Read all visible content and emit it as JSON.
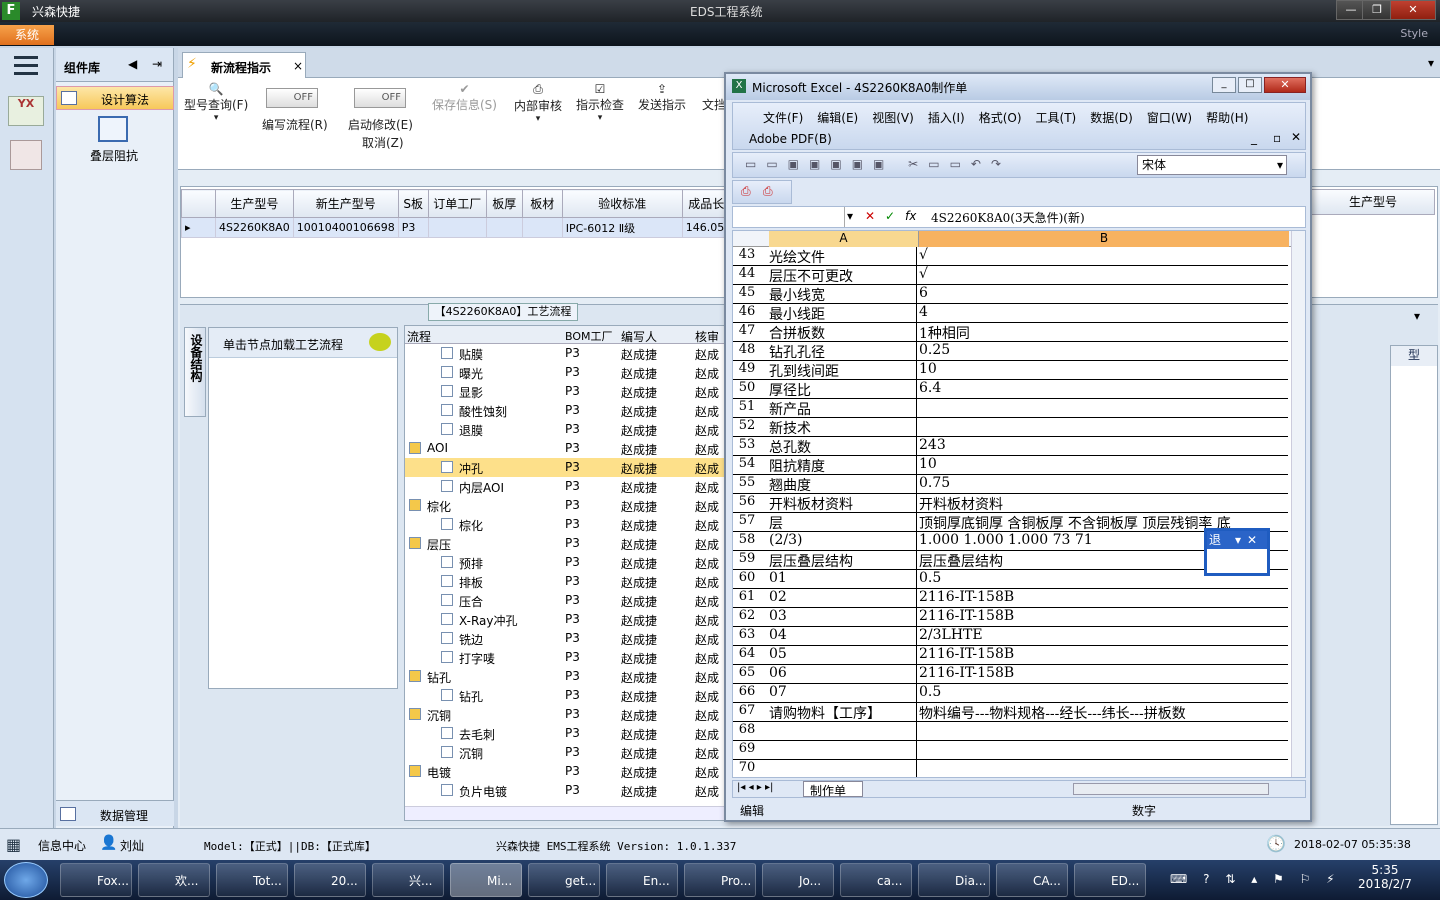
{
  "app": {
    "title": "兴森快捷",
    "window_title": "EDS工程系统",
    "style_label": "Style",
    "system_btn": "系统"
  },
  "left": {
    "panel_title": "组件库",
    "items": [
      {
        "label": "设计算法"
      },
      {
        "label": "叠层阻抗"
      }
    ],
    "bottom_item": "数据管理"
  },
  "tab": {
    "label": "新流程指示"
  },
  "toolbar": {
    "model_query": "型号查询(F)",
    "write_flow": "编写流程(R)",
    "modify": "启动修改(E)",
    "cancel": "取消(Z)",
    "save_info": "保存信息(S)",
    "internal_review": "内部审核",
    "check": "指示检查",
    "send": "发送指示",
    "doc": "文挡",
    "off": "OFF"
  },
  "grid": {
    "headers": [
      "生产型号",
      "新生产型号",
      "S板",
      "订单工厂",
      "板厚",
      "板材",
      "验收标准",
      "成品长"
    ],
    "row": [
      "4S2260K8A0",
      "10010400106698",
      "P3",
      "",
      "",
      "",
      "IPC-6012 Ⅱ级",
      "146.05"
    ],
    "right_header": "生产型号"
  },
  "flow": {
    "title": "【4S2260K8A0】工艺流程",
    "side_tab": "设备结构",
    "load_btn": "单击节点加载工艺流程",
    "cols": [
      "流程",
      "BOM工厂",
      "编写人",
      "核审"
    ],
    "rows": [
      {
        "name": "贴膜",
        "lvl": 2,
        "bom": "P3",
        "w": "赵成捷",
        "r": "赵成"
      },
      {
        "name": "曝光",
        "lvl": 2,
        "bom": "P3",
        "w": "赵成捷",
        "r": "赵成"
      },
      {
        "name": "显影",
        "lvl": 2,
        "bom": "P3",
        "w": "赵成捷",
        "r": "赵成"
      },
      {
        "name": "酸性蚀刻",
        "lvl": 2,
        "bom": "P3",
        "w": "赵成捷",
        "r": "赵成"
      },
      {
        "name": "退膜",
        "lvl": 2,
        "bom": "P3",
        "w": "赵成捷",
        "r": "赵成"
      },
      {
        "name": "AOI",
        "lvl": 1,
        "bom": "P3",
        "w": "赵成捷",
        "r": "赵成"
      },
      {
        "name": "冲孔",
        "lvl": 2,
        "bom": "P3",
        "w": "赵成捷",
        "r": "赵成",
        "sel": true
      },
      {
        "name": "内层AOI",
        "lvl": 2,
        "bom": "P3",
        "w": "赵成捷",
        "r": "赵成"
      },
      {
        "name": "棕化",
        "lvl": 1,
        "bom": "P3",
        "w": "赵成捷",
        "r": "赵成"
      },
      {
        "name": "棕化",
        "lvl": 2,
        "bom": "P3",
        "w": "赵成捷",
        "r": "赵成"
      },
      {
        "name": "层压",
        "lvl": 1,
        "bom": "P3",
        "w": "赵成捷",
        "r": "赵成"
      },
      {
        "name": "预排",
        "lvl": 2,
        "bom": "P3",
        "w": "赵成捷",
        "r": "赵成"
      },
      {
        "name": "排板",
        "lvl": 2,
        "bom": "P3",
        "w": "赵成捷",
        "r": "赵成"
      },
      {
        "name": "压合",
        "lvl": 2,
        "bom": "P3",
        "w": "赵成捷",
        "r": "赵成"
      },
      {
        "name": "X-Ray冲孔",
        "lvl": 2,
        "bom": "P3",
        "w": "赵成捷",
        "r": "赵成"
      },
      {
        "name": "铣边",
        "lvl": 2,
        "bom": "P3",
        "w": "赵成捷",
        "r": "赵成"
      },
      {
        "name": "打字唛",
        "lvl": 2,
        "bom": "P3",
        "w": "赵成捷",
        "r": "赵成"
      },
      {
        "name": "钻孔",
        "lvl": 1,
        "bom": "P3",
        "w": "赵成捷",
        "r": "赵成"
      },
      {
        "name": "钻孔",
        "lvl": 2,
        "bom": "P3",
        "w": "赵成捷",
        "r": "赵成"
      },
      {
        "name": "沉铜",
        "lvl": 1,
        "bom": "P3",
        "w": "赵成捷",
        "r": "赵成"
      },
      {
        "name": "去毛刺",
        "lvl": 2,
        "bom": "P3",
        "w": "赵成捷",
        "r": "赵成"
      },
      {
        "name": "沉铜",
        "lvl": 2,
        "bom": "P3",
        "w": "赵成捷",
        "r": "赵成"
      },
      {
        "name": "电镀",
        "lvl": 1,
        "bom": "P3",
        "w": "赵成捷",
        "r": "赵成"
      },
      {
        "name": "负片电镀",
        "lvl": 2,
        "bom": "P3",
        "w": "赵成捷",
        "r": "赵成"
      }
    ]
  },
  "excel": {
    "title": "Microsoft Excel - 4S2260K8A0制作单",
    "menus": [
      "文件(F)",
      "编辑(E)",
      "视图(V)",
      "插入(I)",
      "格式(O)",
      "工具(T)",
      "数据(D)",
      "窗口(W)",
      "帮助(H)"
    ],
    "adobe": "Adobe PDF(B)",
    "font": "宋体",
    "formula": "4S2260K8A0(3天急件)(新)",
    "col_a": "A",
    "col_b": "B",
    "sheet_tab": "制作单",
    "status_left": "编辑",
    "status_mid": "数字",
    "popup": "退",
    "rows": [
      [
        "43",
        "光绘文件",
        "√"
      ],
      [
        "44",
        "层压不可更改",
        "√"
      ],
      [
        "45",
        "最小线宽",
        "6"
      ],
      [
        "46",
        "最小线距",
        "4"
      ],
      [
        "47",
        "合拼板数",
        "1种相同"
      ],
      [
        "48",
        "钻孔孔径",
        "0.25"
      ],
      [
        "49",
        "孔到线间距",
        "10"
      ],
      [
        "50",
        "厚径比",
        "6.4"
      ],
      [
        "51",
        "新产品",
        ""
      ],
      [
        "52",
        "新技术",
        ""
      ],
      [
        "53",
        "总孔数",
        "243"
      ],
      [
        "54",
        "阻抗精度",
        "10"
      ],
      [
        "55",
        "翘曲度",
        "0.75"
      ],
      [
        "56",
        "开料板材资料",
        "开料板材资料"
      ],
      [
        "57",
        "层",
        "顶铜厚底铜厚  含铜板厚  不含铜板厚  顶层残铜率  底"
      ],
      [
        "58",
        "(2/3)",
        "1.000   1.000    1.000            73  71"
      ],
      [
        "59",
        "层压叠层结构",
        "层压叠层结构"
      ],
      [
        "60",
        "01",
        "0.5"
      ],
      [
        "61",
        "02",
        "2116-IT-158B"
      ],
      [
        "62",
        "03",
        "2116-IT-158B"
      ],
      [
        "63",
        "04",
        "2/3LHTE"
      ],
      [
        "64",
        "05",
        "2116-IT-158B"
      ],
      [
        "65",
        "06",
        "2116-IT-158B"
      ],
      [
        "66",
        "07",
        "0.5"
      ],
      [
        "67",
        "请购物料【工序】",
        "物料编号---物料规格---经长---纬长---拼板数"
      ],
      [
        "68",
        "",
        ""
      ],
      [
        "69",
        "",
        ""
      ],
      [
        "70",
        "",
        ""
      ]
    ]
  },
  "status": {
    "info": "信息中心",
    "user": "刘灿",
    "model": "Model:【正式】||DB:【正式库】",
    "center": "兴森快捷 EMS工程系统 Version: 1.0.1.337",
    "time": "2018-02-07 05:35:38"
  },
  "taskbar": {
    "items": [
      "Fox...",
      "欢...",
      "Tot...",
      "20...",
      "兴...",
      "Mi...",
      "get...",
      "En...",
      "Pro...",
      "Jo...",
      "ca...",
      "Dia...",
      "CA...",
      "ED..."
    ],
    "clock_time": "5:35",
    "clock_date": "2018/2/7"
  },
  "right_side_text": "型"
}
